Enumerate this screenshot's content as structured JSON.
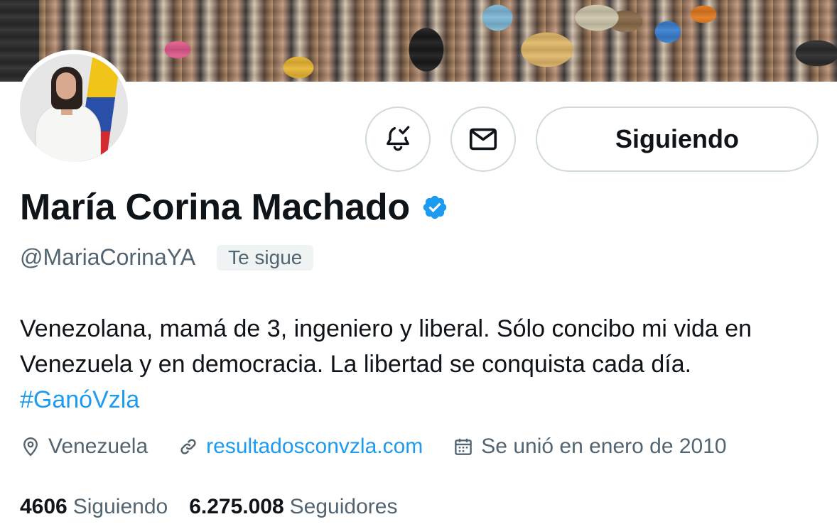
{
  "profile": {
    "name": "María Corina Machado",
    "handle": "@MariaCorinaYA",
    "follows_you": "Te sigue",
    "verified": true,
    "bio": {
      "line1": "Venezolana, mamá de 3, ingeniero y liberal. Sólo concibo mi vida en",
      "line2": "Venezuela y en democracia. La libertad se conquista cada día.",
      "hashtag": "#GanóVzla"
    },
    "location": "Venezuela",
    "website": "resultadosconvzla.com",
    "joined": "Se unió en enero de 2010"
  },
  "actions": {
    "notifications_icon": "bell-check-icon",
    "message_icon": "envelope-icon",
    "follow_label": "Siguiendo"
  },
  "stats": {
    "following_count": "4606",
    "following_label": "Siguiendo",
    "followers_count": "6.275.008",
    "followers_label": "Seguidores"
  },
  "colors": {
    "accent": "#1d9bf0",
    "secondary_text": "#536471",
    "primary_text": "#0f1419",
    "border": "#cfd9de"
  }
}
